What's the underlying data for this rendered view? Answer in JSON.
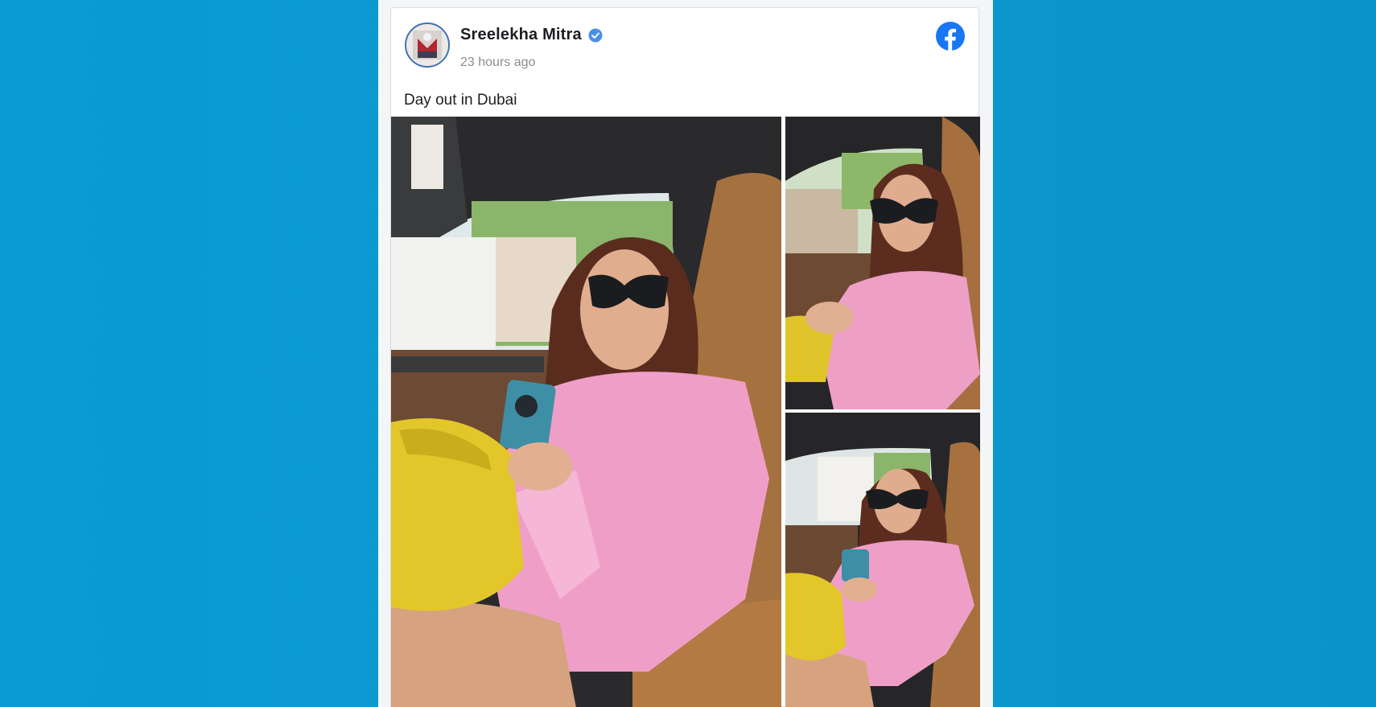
{
  "post": {
    "author_name": "Sreelekha Mitra",
    "verified": true,
    "timestamp": "23 hours ago",
    "text": "Day out in Dubai",
    "platform_icon": "facebook-icon",
    "avatar_icon": "profile-avatar",
    "photos": [
      {
        "name": "photo-main",
        "subject": "woman-in-car-selfie"
      },
      {
        "name": "photo-top-right",
        "subject": "woman-in-car-selfie"
      },
      {
        "name": "photo-bottom-right",
        "subject": "woman-in-car-selfie"
      }
    ]
  },
  "colors": {
    "background": "#0b9ad1",
    "card": "#ffffff",
    "name": "#1c1e21",
    "timestamp": "#8a8d91",
    "facebook_blue": "#1877f2",
    "verified_blue": "#4a8ee8"
  }
}
